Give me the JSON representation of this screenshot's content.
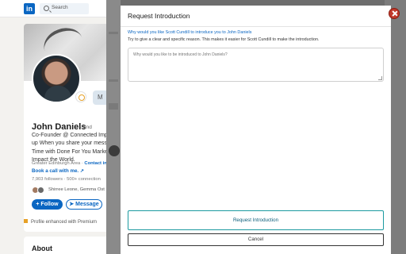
{
  "nav": {
    "search_placeholder": "Search"
  },
  "profile": {
    "name": "John Daniels",
    "degree": "· 2nd",
    "headline": "Co-Founder @ Connected Impa\nup When you share your message\nTime with Done For You Market\nImpact the World.",
    "location_text": "Greater Edinburgh Area · ",
    "contact_link": "Contact in",
    "book_link": "Book a call with me. ↗",
    "followers": "7,903 followers · 500+ connection",
    "mutuals": "Shirree Leone, Gemma Ost",
    "follow_label": "+ Follow",
    "message_label": "➤ Message",
    "behind_pill": "M",
    "enhanced": "Profile enhanced with Premium",
    "about_title": "About"
  },
  "modal": {
    "title": "Request Introduction",
    "why_label": "Why would you like Scott Cundill to introduce you to John Daniels",
    "tip": "Try to give a clear and specific reason. This makes it easier for Scott Cundill to make the introduction.",
    "textarea_placeholder": "Why would you like to be introduced to John Daniels?",
    "textarea_value": "",
    "primary_label": "Request Introduction",
    "cancel_label": "Cancel"
  },
  "colors": {
    "brand": "#0a66c2",
    "close": "#c0392b",
    "primary_border": "#1b9aa0"
  }
}
